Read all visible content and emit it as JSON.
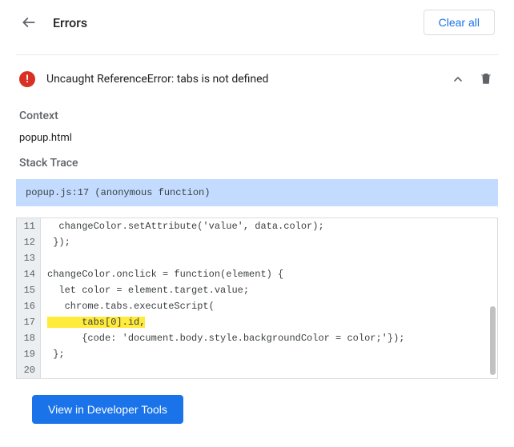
{
  "header": {
    "title": "Errors",
    "clear_all_label": "Clear all"
  },
  "error": {
    "message": "Uncaught ReferenceError: tabs is not defined"
  },
  "context": {
    "label": "Context",
    "value": "popup.html"
  },
  "stack": {
    "label": "Stack Trace",
    "frame": "popup.js:17 (anonymous function)"
  },
  "code": {
    "lines": [
      {
        "num": "11",
        "text": "  changeColor.setAttribute('value', data.color);",
        "hl": false
      },
      {
        "num": "12",
        "text": " });",
        "hl": false
      },
      {
        "num": "13",
        "text": "",
        "hl": false
      },
      {
        "num": "14",
        "text": "changeColor.onclick = function(element) {",
        "hl": false
      },
      {
        "num": "15",
        "text": "  let color = element.target.value;",
        "hl": false
      },
      {
        "num": "16",
        "text": "   chrome.tabs.executeScript(",
        "hl": false
      },
      {
        "num": "17",
        "text": "      tabs[0].id,",
        "hl": true
      },
      {
        "num": "18",
        "text": "      {code: 'document.body.style.backgroundColor = color;'});",
        "hl": false
      },
      {
        "num": "19",
        "text": " };",
        "hl": false
      },
      {
        "num": "20",
        "text": "",
        "hl": false
      }
    ]
  },
  "footer": {
    "devtools_label": "View in Developer Tools"
  }
}
